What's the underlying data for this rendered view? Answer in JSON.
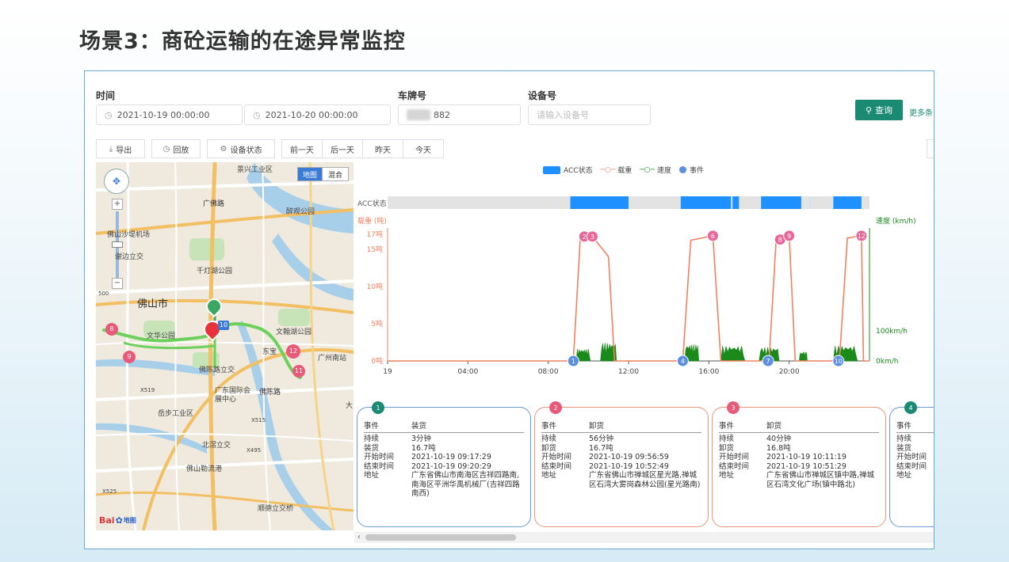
{
  "slide": {
    "title": "场景3：商砼运输的在途异常监控"
  },
  "filters": {
    "time_label": "时间",
    "start_time": "2021-10-19 00:00:00",
    "end_time": "2021-10-20 00:00:00",
    "plate_label": "车牌号",
    "plate_value": "882",
    "device_label": "设备号",
    "device_placeholder": "请输入设备号",
    "query_label": "查询",
    "more_label": "更多条"
  },
  "toolbar": {
    "export": "导出",
    "playback": "回放",
    "device_status": "设备状态",
    "prev_day": "前一天",
    "next_day": "后一天",
    "yesterday": "昨天",
    "today": "今天"
  },
  "map": {
    "type_map": "地图",
    "type_hybrid": "混合",
    "scale": "500",
    "logo": "Bai",
    "logo_suffix": "地图",
    "labels": {
      "park": "景兴工业区",
      "guangfo": "广佛路",
      "city": "佛山市",
      "wenhua": "文华公园",
      "qiandeng": "千灯湖公园",
      "foshan_airport": "佛山沙堤机场",
      "xiangzhen": "谢边立交",
      "fengyu": "醉观公园",
      "wenhan": "文翰湖公园",
      "foluo": "佛陈路立交",
      "fochen": "佛陈路",
      "gz_south": "广州南站",
      "dongbao": "东宝",
      "exhibition": "广东国际会展中心",
      "yuebu": "岳步工业区",
      "beijiao": "北滘立交",
      "xiamen": "佛山勒流港",
      "shunde": "顺德立交桥",
      "x519": "X519",
      "x515": "X515",
      "x525": "X525",
      "x495": "X495",
      "da": "大"
    },
    "markers": {
      "m8": "8",
      "m9": "9",
      "m10": "10",
      "m12": "12",
      "m11": "11"
    }
  },
  "colors": {
    "acc": "#1e90ff",
    "load": "#f08060",
    "speed": "#1a8a1a",
    "event": "#5b8fe0",
    "accent": "#1a8a73"
  },
  "chart_data": {
    "type": "line",
    "legend": [
      "ACC状态",
      "载重",
      "速度",
      "事件"
    ],
    "acc_label": "ACC状态",
    "y_left_label": "载重 (吨)",
    "y_right_label": "速度 (km/h)",
    "y_left_ticks": [
      "17吨",
      "15吨",
      "10吨",
      "5吨",
      "0吨"
    ],
    "y_left_values": [
      17,
      15,
      10,
      5,
      0
    ],
    "y_right_ticks": [
      "100km/h",
      "0km/h"
    ],
    "y_right_values": [
      100,
      0
    ],
    "x_ticks": [
      "19",
      "04:00",
      "08:00",
      "12:00",
      "16:00",
      "20:00"
    ],
    "x_tick_hours": [
      0,
      4,
      8,
      12,
      16,
      20
    ],
    "x_range_hours": [
      0,
      24
    ],
    "acc_on": [
      [
        9.1,
        12.0
      ],
      [
        14.6,
        17.5
      ],
      [
        18.6,
        20.6
      ],
      [
        22.2,
        23.6
      ]
    ],
    "acc_ticks": [
      17.1,
      21.0
    ],
    "load": {
      "x": [
        0,
        9.25,
        9.6,
        10.2,
        11.0,
        11.3,
        14.7,
        15.1,
        16.2,
        16.6,
        19.0,
        19.35,
        20.0,
        20.3,
        22.5,
        22.9,
        23.6,
        23.7,
        24
      ],
      "y": [
        0,
        0,
        16.7,
        16.7,
        14,
        0,
        0,
        16.2,
        16.8,
        0,
        0,
        16.3,
        16.8,
        0,
        0,
        16.5,
        16.8,
        0,
        0
      ]
    },
    "speed_bursts": [
      [
        9.4,
        10.1,
        40
      ],
      [
        10.6,
        11.4,
        60
      ],
      [
        14.8,
        15.5,
        55
      ],
      [
        16.6,
        17.8,
        50
      ],
      [
        18.5,
        19.5,
        45
      ],
      [
        20.5,
        20.9,
        30
      ],
      [
        22.2,
        23.4,
        50
      ]
    ],
    "events": [
      {
        "id": "1",
        "x": 9.25,
        "y": 0
      },
      {
        "id": "2",
        "x": 9.8,
        "y": 16.7
      },
      {
        "id": "3",
        "x": 10.2,
        "y": 16.7
      },
      {
        "id": "4",
        "x": 14.7,
        "y": 0
      },
      {
        "id": "6",
        "x": 16.2,
        "y": 16.8
      },
      {
        "id": "7",
        "x": 18.95,
        "y": 0
      },
      {
        "id": "8",
        "x": 19.55,
        "y": 16.3
      },
      {
        "id": "9",
        "x": 20.0,
        "y": 16.8
      },
      {
        "id": "10",
        "x": 22.45,
        "y": 0
      },
      {
        "id": "12",
        "x": 23.6,
        "y": 16.8
      }
    ]
  },
  "events_header": {
    "k": "事件"
  },
  "cards": [
    {
      "num": "1",
      "color": "#1a8a73",
      "border": "#6a9ad4",
      "type": "装货",
      "rows": [
        [
          "持续",
          "3分钟"
        ],
        [
          "装货",
          "16.7吨"
        ],
        [
          "开始时间",
          "2021-10-19 09:17:29"
        ],
        [
          "结束时间",
          "2021-10-19 09:20:29"
        ],
        [
          "地址",
          "广东省佛山市南海区吉祥四路南,南海区平洲华禹机械厂(吉祥四路南西)"
        ]
      ]
    },
    {
      "num": "2",
      "color": "#e85a7a",
      "border": "#e8957a",
      "type": "卸货",
      "rows": [
        [
          "持续",
          "56分钟"
        ],
        [
          "卸货",
          "16.7吨"
        ],
        [
          "开始时间",
          "2021-10-19 09:56:59"
        ],
        [
          "结束时间",
          "2021-10-19 10:52:49"
        ],
        [
          "地址",
          "广东省佛山市禅城区星光路,禅城区石湾大雾岗森林公园(星光路南)"
        ]
      ]
    },
    {
      "num": "3",
      "color": "#e85a7a",
      "border": "#e8957a",
      "type": "卸货",
      "rows": [
        [
          "持续",
          "40分钟"
        ],
        [
          "卸货",
          "16.8吨"
        ],
        [
          "开始时间",
          "2021-10-19 10:11:19"
        ],
        [
          "结束时间",
          "2021-10-19 10:51:29"
        ],
        [
          "地址",
          "广东省佛山市禅城区镇中路,禅城区石湾文化广场(镇中路北)"
        ]
      ]
    },
    {
      "num": "4",
      "color": "#1a8a73",
      "border": "#6a9ad4",
      "type": "",
      "rows": [
        [
          "持续",
          ""
        ],
        [
          "装货",
          ""
        ],
        [
          "开始时间",
          ""
        ],
        [
          "结束时间",
          ""
        ],
        [
          "地址",
          ""
        ]
      ]
    }
  ]
}
